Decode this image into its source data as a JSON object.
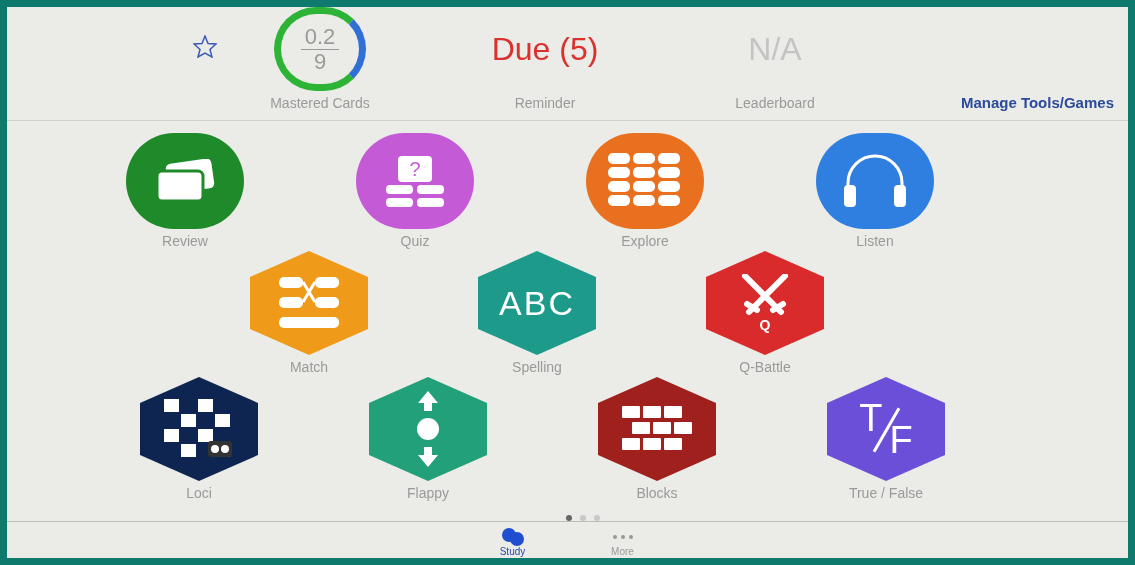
{
  "header": {
    "starred": false,
    "stats": [
      {
        "kind": "ring",
        "numerator": "0.2",
        "denominator": "9",
        "label": "Mastered Cards"
      },
      {
        "kind": "alert",
        "value": "Due (5)",
        "label": "Reminder"
      },
      {
        "kind": "empty",
        "value": "N/A",
        "label": "Leaderboard"
      }
    ],
    "manage_link": "Manage Tools/Games"
  },
  "tool_rows": [
    [
      {
        "label": "Review",
        "color": "#1f8a2a"
      },
      {
        "label": "Quiz",
        "color": "#c55ad6",
        "glyph": "?"
      },
      {
        "label": "Explore",
        "color": "#e8701e"
      },
      {
        "label": "Listen",
        "color": "#2f7fe0"
      }
    ],
    [
      {
        "label": "Match",
        "color": "#f09a1a"
      },
      {
        "label": "Spelling",
        "color": "#1d9a8a",
        "glyph": "ABC"
      },
      {
        "label": "Q-Battle",
        "color": "#d92b2b",
        "glyph": "Q"
      }
    ],
    [
      {
        "label": "Loci",
        "color": "#0d2550"
      },
      {
        "label": "Flappy",
        "color": "#22a07a"
      },
      {
        "label": "Blocks",
        "color": "#a0201e"
      },
      {
        "label": "True / False",
        "color": "#6b4fd8",
        "glyph": "TF"
      }
    ]
  ],
  "page_dots": [
    {
      "selected": true
    },
    {
      "selected": false
    },
    {
      "selected": false
    }
  ],
  "tabs": [
    {
      "label": "Study",
      "selected": true
    },
    {
      "label": "More",
      "selected": false
    }
  ]
}
